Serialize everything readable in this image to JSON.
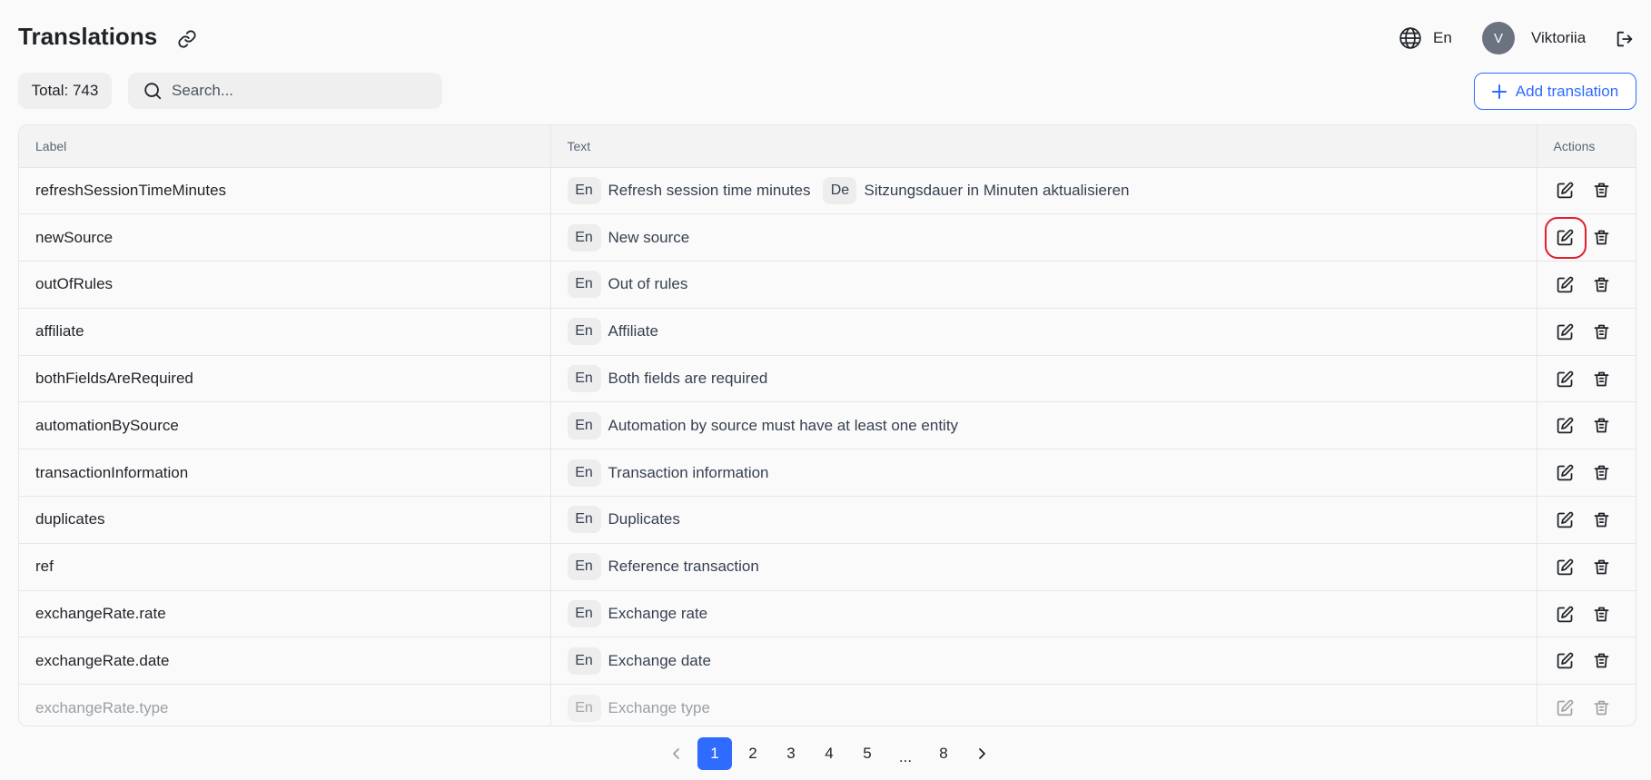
{
  "header": {
    "title": "Translations",
    "language": "En",
    "user": {
      "initial": "V",
      "name": "Viktoriia"
    }
  },
  "toolbar": {
    "total_label": "Total: 743",
    "search_placeholder": "Search...",
    "add_label": "Add translation"
  },
  "table": {
    "columns": [
      "Label",
      "Text",
      "Actions"
    ],
    "rows": [
      {
        "label": "refreshSessionTimeMinutes",
        "texts": [
          {
            "lang": "En",
            "text": "Refresh session time minutes"
          },
          {
            "lang": "De",
            "text": "Sitzungsdauer in Minuten aktualisieren"
          }
        ]
      },
      {
        "label": "newSource",
        "texts": [
          {
            "lang": "En",
            "text": "New source"
          }
        ]
      },
      {
        "label": "outOfRules",
        "texts": [
          {
            "lang": "En",
            "text": "Out of rules"
          }
        ]
      },
      {
        "label": "affiliate",
        "texts": [
          {
            "lang": "En",
            "text": "Affiliate"
          }
        ]
      },
      {
        "label": "bothFieldsAreRequired",
        "texts": [
          {
            "lang": "En",
            "text": "Both fields are required"
          }
        ]
      },
      {
        "label": "automationBySource",
        "texts": [
          {
            "lang": "En",
            "text": "Automation by source must have at least one entity"
          }
        ]
      },
      {
        "label": "transactionInformation",
        "texts": [
          {
            "lang": "En",
            "text": "Transaction information"
          }
        ]
      },
      {
        "label": "duplicates",
        "texts": [
          {
            "lang": "En",
            "text": "Duplicates"
          }
        ]
      },
      {
        "label": "ref",
        "texts": [
          {
            "lang": "En",
            "text": "Reference transaction"
          }
        ]
      },
      {
        "label": "exchangeRate.rate",
        "texts": [
          {
            "lang": "En",
            "text": "Exchange rate"
          }
        ]
      },
      {
        "label": "exchangeRate.date",
        "texts": [
          {
            "lang": "En",
            "text": "Exchange date"
          }
        ]
      },
      {
        "label": "exchangeRate.type",
        "texts": [
          {
            "lang": "En",
            "text": "Exchange type"
          }
        ]
      }
    ]
  },
  "pagination": {
    "pages": [
      "1",
      "2",
      "3",
      "4",
      "5",
      "...",
      "8"
    ],
    "current": "1"
  },
  "colors": {
    "accent": "#2f6bff",
    "highlight": "#e11d2e"
  }
}
